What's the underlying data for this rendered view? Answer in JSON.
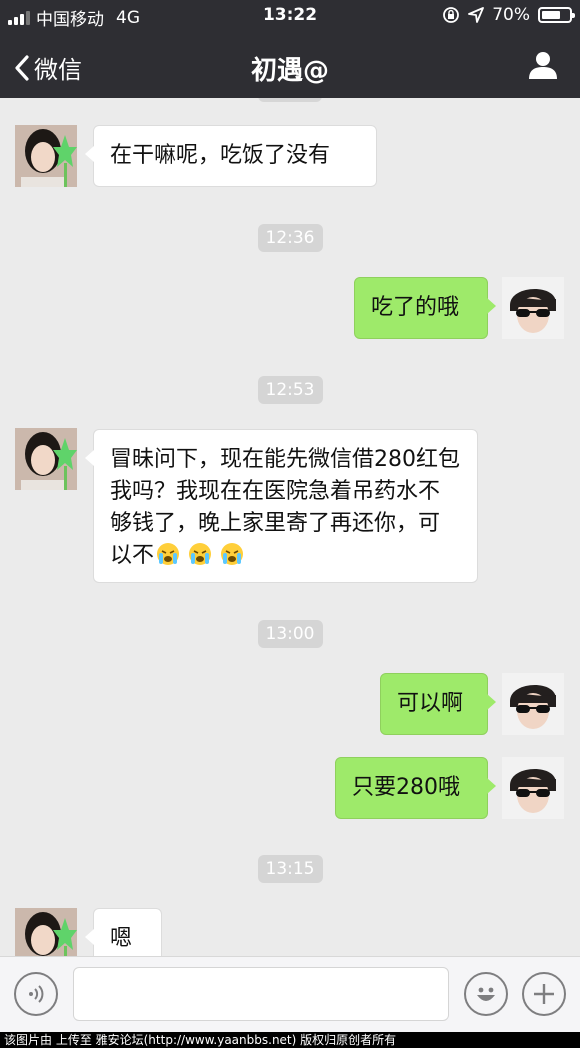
{
  "status_bar": {
    "carrier": "中国移动",
    "network": "4G",
    "time": "13:22",
    "battery": "70%",
    "battery_level": 0.7
  },
  "nav": {
    "back_label": "微信",
    "title": "初遇@"
  },
  "messages": [
    {
      "sender": "contact",
      "text": "在干嘛呢，吃饭了没有"
    },
    {
      "timestamp": "12:36"
    },
    {
      "sender": "me",
      "text": "吃了的哦"
    },
    {
      "timestamp": "12:53"
    },
    {
      "sender": "contact",
      "text": "冒昧问下，现在能先微信借280红包我吗？我现在在医院急着吊药水不够钱了，晚上家里寄了再还你，可以不",
      "emoji": [
        "crying-face",
        "crying-face",
        "crying-face"
      ]
    },
    {
      "timestamp": "13:00"
    },
    {
      "sender": "me",
      "text": "可以啊"
    },
    {
      "sender": "me",
      "text": "只要280哦"
    },
    {
      "timestamp": "13:15"
    },
    {
      "sender": "contact",
      "text": "嗯"
    }
  ],
  "input": {
    "placeholder": ""
  },
  "footer": {
    "text": "该图片由  上传至 雅安论坛(http://www.yaanbbs.net) 版权归原创者所有"
  },
  "colors": {
    "nav_bg": "#2e2e33",
    "chat_bg": "#ebebeb",
    "my_bubble": "#9eea6a",
    "their_bubble": "#ffffff"
  }
}
